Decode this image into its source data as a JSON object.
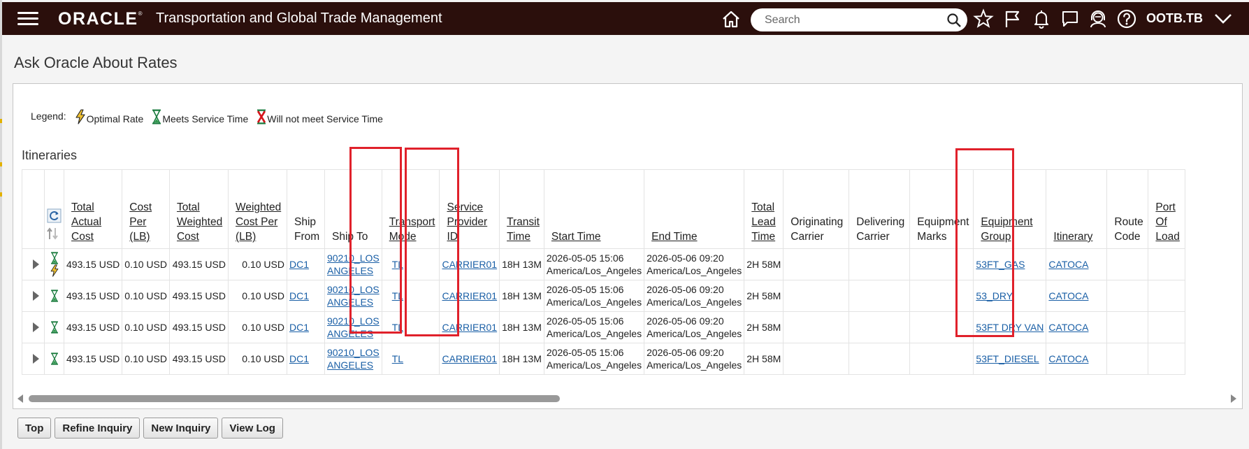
{
  "header": {
    "logo": "ORACLE",
    "logo_mark": "®",
    "title": "Transportation and Global Trade Management",
    "search_placeholder": "Search",
    "user": "OOTB.TB",
    "bg_color": "#2b0f0c"
  },
  "page": {
    "title": "Ask Oracle About Rates"
  },
  "legend": {
    "label": "Legend:",
    "items": [
      {
        "label": "Optimal Rate",
        "icon": "lightning-icon"
      },
      {
        "label": "Meets Service Time",
        "icon": "hourglass-green-icon"
      },
      {
        "label": "Will not meet Service Time",
        "icon": "hourglass-red-x-icon"
      }
    ]
  },
  "itineraries": {
    "title": "Itineraries",
    "columns": [
      "Total Actual Cost",
      "Cost Per (LB)",
      "Total Weighted Cost",
      "Weighted Cost Per (LB)",
      "Ship From",
      "Ship To",
      "Transport Mode",
      "Service Provider ID",
      "Transit Time",
      "Start Time",
      "End Time",
      "Total Lead Time",
      "Originating Carrier",
      "Delivering Carrier",
      "Equipment Marks",
      "Equipment Group",
      "Itinerary",
      "Route Code",
      "Port Of Load"
    ],
    "rows": [
      {
        "optimal": true,
        "total_actual_cost": "493.15 USD",
        "cost_per_lb": "0.10 USD",
        "total_weighted_cost": "493.15 USD",
        "weighted_cost_per_lb": "0.10 USD",
        "ship_from": "DC1",
        "ship_to": "90210_LOS ANGELES",
        "transport_mode": "TL",
        "service_provider_id": "CARRIER01",
        "transit_time": "18H 13M",
        "start_time": "2026-05-05 15:06 America/Los_Angeles",
        "end_time": "2026-05-06 09:20 America/Los_Angeles",
        "total_lead_time": "2H 58M",
        "originating_carrier": "",
        "delivering_carrier": "",
        "equipment_marks": "",
        "equipment_group": "53FT_GAS",
        "itinerary": "CATOCA",
        "route_code": "",
        "port_of_load": ""
      },
      {
        "optimal": false,
        "total_actual_cost": "493.15 USD",
        "cost_per_lb": "0.10 USD",
        "total_weighted_cost": "493.15 USD",
        "weighted_cost_per_lb": "0.10 USD",
        "ship_from": "DC1",
        "ship_to": "90210_LOS ANGELES",
        "transport_mode": "TL",
        "service_provider_id": "CARRIER01",
        "transit_time": "18H 13M",
        "start_time": "2026-05-05 15:06 America/Los_Angeles",
        "end_time": "2026-05-06 09:20 America/Los_Angeles",
        "total_lead_time": "2H 58M",
        "originating_carrier": "",
        "delivering_carrier": "",
        "equipment_marks": "",
        "equipment_group": "53_DRY",
        "itinerary": "CATOCA",
        "route_code": "",
        "port_of_load": ""
      },
      {
        "optimal": false,
        "total_actual_cost": "493.15 USD",
        "cost_per_lb": "0.10 USD",
        "total_weighted_cost": "493.15 USD",
        "weighted_cost_per_lb": "0.10 USD",
        "ship_from": "DC1",
        "ship_to": "90210_LOS ANGELES",
        "transport_mode": "TL",
        "service_provider_id": "CARRIER01",
        "transit_time": "18H 13M",
        "start_time": "2026-05-05 15:06 America/Los_Angeles",
        "end_time": "2026-05-06 09:20 America/Los_Angeles",
        "total_lead_time": "2H 58M",
        "originating_carrier": "",
        "delivering_carrier": "",
        "equipment_marks": "",
        "equipment_group": "53FT DRY VAN",
        "itinerary": "CATOCA",
        "route_code": "",
        "port_of_load": ""
      },
      {
        "optimal": false,
        "total_actual_cost": "493.15 USD",
        "cost_per_lb": "0.10 USD",
        "total_weighted_cost": "493.15 USD",
        "weighted_cost_per_lb": "0.10 USD",
        "ship_from": "DC1",
        "ship_to": "90210_LOS ANGELES",
        "transport_mode": "TL",
        "service_provider_id": "CARRIER01",
        "transit_time": "18H 13M",
        "start_time": "2026-05-05 15:06 America/Los_Angeles",
        "end_time": "2026-05-06 09:20 America/Los_Angeles",
        "total_lead_time": "2H 58M",
        "originating_carrier": "",
        "delivering_carrier": "",
        "equipment_marks": "",
        "equipment_group": "53FT_DIESEL",
        "itinerary": "CATOCA",
        "route_code": "",
        "port_of_load": ""
      }
    ]
  },
  "buttons": [
    "Top",
    "Refine Inquiry",
    "New Inquiry",
    "View Log"
  ],
  "highlight_color": "#e0212b"
}
